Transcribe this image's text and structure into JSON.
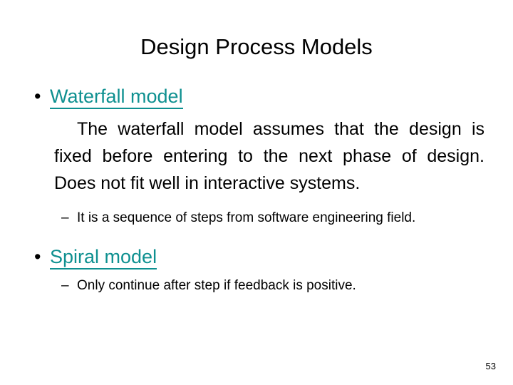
{
  "slide": {
    "title": "Design Process Models",
    "page_number": "53",
    "accent_color": "#0E9090",
    "text_color": "#000000",
    "background_color": "#FFFFFF"
  },
  "content": {
    "bullets": [
      {
        "marker": "•",
        "label": "Waterfall model",
        "paragraph": "The waterfall model assumes that the design is fixed before entering to the next phase of design. Does not fit well in interactive systems.",
        "sub_marker": "–",
        "sub_text": "It is a sequence of steps from software engineering field."
      },
      {
        "marker": "•",
        "label": "Spiral model",
        "sub_marker": "–",
        "sub_text": "Only continue after step if feedback is positive."
      }
    ]
  }
}
